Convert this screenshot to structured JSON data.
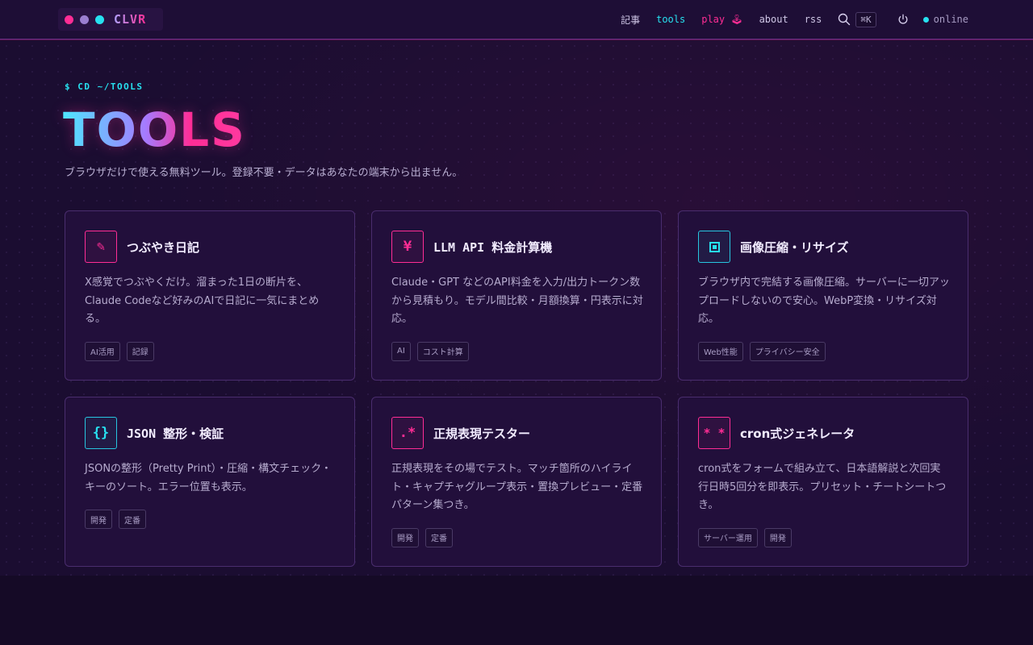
{
  "brand": {
    "name": "CLVR",
    "dots": [
      "#ff2d95",
      "#9b7fd0",
      "#27e1f0"
    ]
  },
  "nav": {
    "items": [
      {
        "label": "記事"
      },
      {
        "label": "tools"
      },
      {
        "label": "play 🕹"
      },
      {
        "label": "about"
      },
      {
        "label": "rss"
      }
    ],
    "shortcut": "⌘K",
    "status": "online"
  },
  "hero": {
    "prompt": "$ CD ~/TOOLS",
    "title": "TOOLS",
    "subtitle": "ブラウザだけで使える無料ツール。登録不要・データはあなたの端末から出ません。"
  },
  "tools": [
    {
      "icon": "✎",
      "title": "つぶやき日記",
      "desc": "X感覚でつぶやくだけ。溜まった1日の断片を、Claude Codeなど好みのAIで日記に一気にまとめる。",
      "tags": [
        "AI活用",
        "記録"
      ]
    },
    {
      "icon": "¥",
      "title": "LLM API 料金計算機",
      "desc": "Claude・GPT などのAPI料金を入力/出力トークン数から見積もり。モデル間比較・月額換算・円表示に対応。",
      "tags": [
        "AI",
        "コスト計算"
      ]
    },
    {
      "icon": "",
      "title": "画像圧縮・リサイズ",
      "desc": "ブラウザ内で完結する画像圧縮。サーバーに一切アップロードしないので安心。WebP変換・リサイズ対応。",
      "tags": [
        "Web性能",
        "プライバシー安全"
      ]
    },
    {
      "icon": "{}",
      "title": "JSON 整形・検証",
      "desc": "JSONの整形（Pretty Print）・圧縮・構文チェック・キーのソート。エラー位置も表示。",
      "tags": [
        "開発",
        "定番"
      ]
    },
    {
      "icon": ".*",
      "title": "正規表現テスター",
      "desc": "正規表現をその場でテスト。マッチ箇所のハイライト・キャプチャグループ表示・置換プレビュー・定番パターン集つき。",
      "tags": [
        "開発",
        "定番"
      ]
    },
    {
      "icon": "* *",
      "title": "cron式ジェネレータ",
      "desc": "cron式をフォームで組み立て、日本語解説と次回実行日時5回分を即表示。プリセット・チートシートつき。",
      "tags": [
        "サーバー運用",
        "開発"
      ]
    }
  ]
}
